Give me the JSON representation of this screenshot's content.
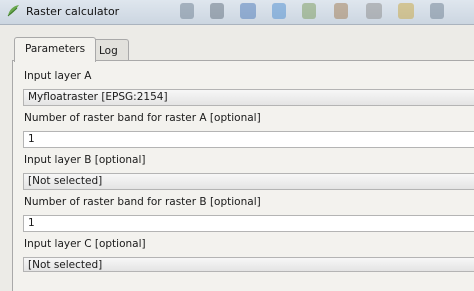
{
  "window": {
    "title": "Raster calculator"
  },
  "tabs": [
    {
      "label": "Parameters",
      "active": true
    },
    {
      "label": "Log",
      "active": false
    }
  ],
  "params": [
    {
      "label": "Input layer A",
      "value": "Myfloatraster [EPSG:2154]",
      "kind": "select"
    },
    {
      "label": "Number of raster band for raster A [optional]",
      "value": "1",
      "kind": "text"
    },
    {
      "label": "Input layer B [optional]",
      "value": "[Not selected]",
      "kind": "select"
    },
    {
      "label": "Number of raster band for raster B [optional]",
      "value": "1",
      "kind": "text"
    },
    {
      "label": "Input layer C [optional]",
      "value": "[Not selected]",
      "kind": "select"
    }
  ],
  "icons": {
    "app": "qgis-logo-icon"
  },
  "colors": {
    "titlebar": "#ccd6e1",
    "panel": "#f3f2ee",
    "field_border": "#b4b4b4"
  }
}
